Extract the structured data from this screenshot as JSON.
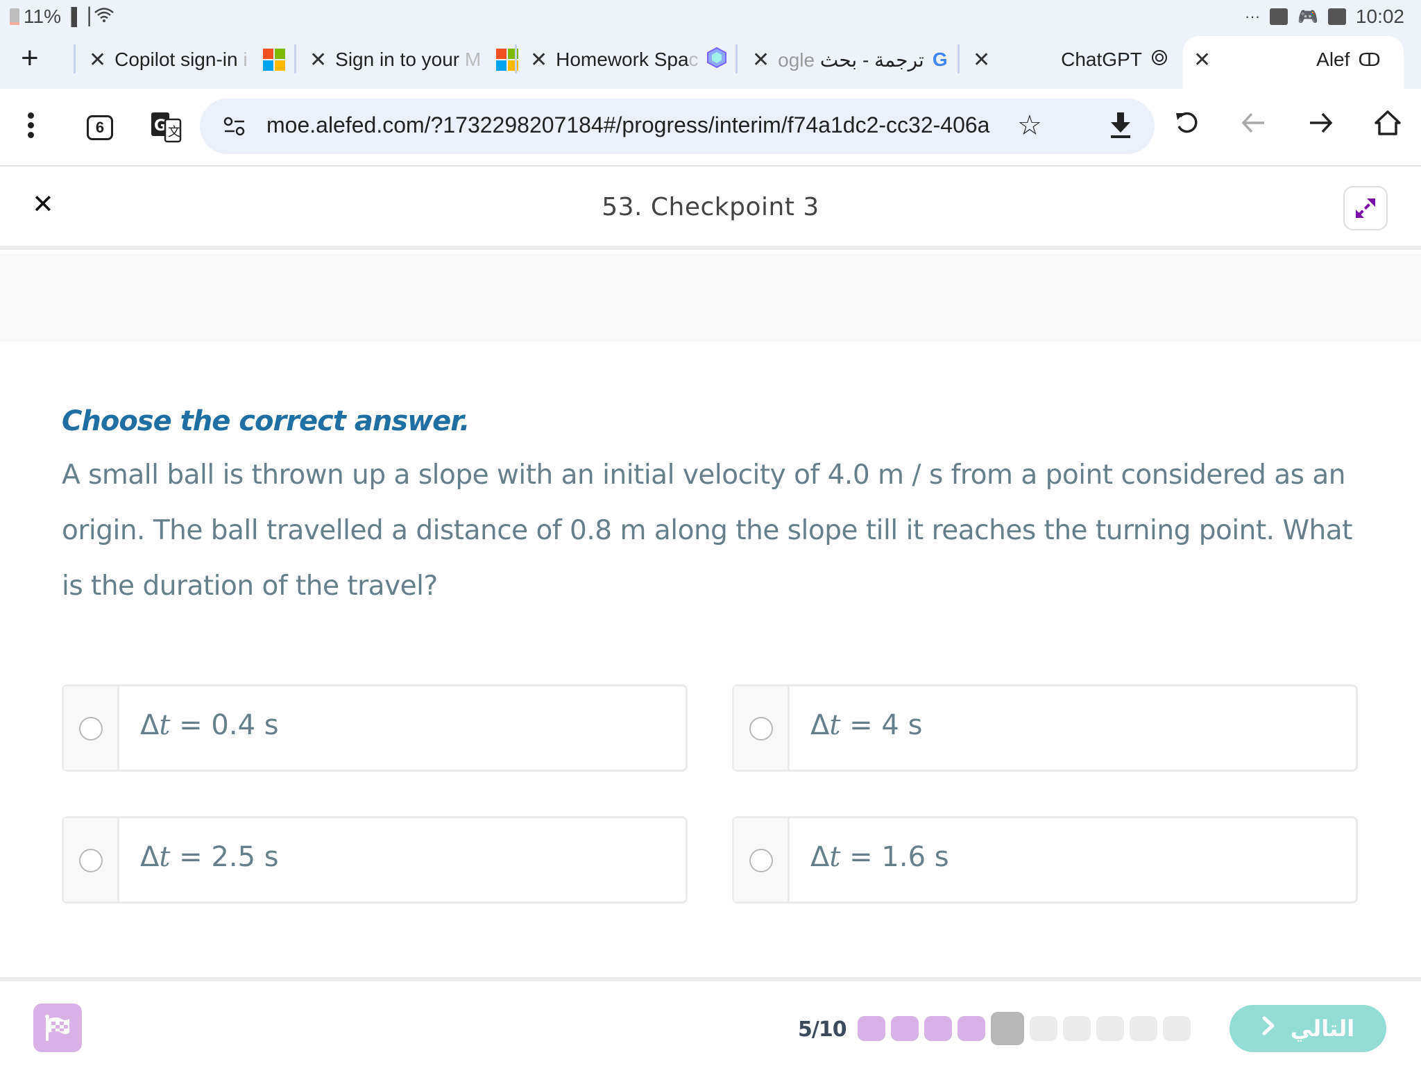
{
  "status_bar": {
    "battery": "11%",
    "time": "10:02",
    "more": "···"
  },
  "tabs": [
    {
      "label": "Copilot sign-in",
      "fade": "i",
      "icon": "microsoft-logo"
    },
    {
      "label": "Sign in to your",
      "fade": "M",
      "icon": "microsoft-logo"
    },
    {
      "label": "Homework Spa",
      "fade": "c",
      "icon": "homework-hex-icon"
    },
    {
      "label": "ترجمة - بحث",
      "fade": "ogle",
      "icon": "google-g-icon"
    },
    {
      "label": "ChatGPT",
      "icon": "openai-icon"
    },
    {
      "label": "Alef",
      "icon": "alef-icon",
      "active": true
    }
  ],
  "toolbar": {
    "tab_count": "6",
    "url": "moe.alefed.com/?1732298207184#/progress/interim/f74a1dc2-cc32-406a"
  },
  "lesson": {
    "title": "53. Checkpoint 3"
  },
  "question": {
    "instruction": "Choose the correct answer.",
    "text": "A small ball is thrown up a slope with an initial velocity of 4.0  m / s from a point considered as an origin. The ball travelled a distance of 0.8  m  along the slope till it reaches the turning point. What is the duration of the travel?",
    "options": [
      {
        "delta": "Δ",
        "var": "t",
        "eq": " = ",
        "value": "0.4 s"
      },
      {
        "delta": "Δ",
        "var": "t",
        "eq": " = ",
        "value": "4 s"
      },
      {
        "delta": "Δ",
        "var": "t",
        "eq": " = ",
        "value": "2.5 s"
      },
      {
        "delta": "Δ",
        "var": "t",
        "eq": " = ",
        "value": "1.6 s"
      }
    ]
  },
  "footer": {
    "progress_label": "5/10",
    "current": 5,
    "total": 10,
    "next_label": "التالي",
    "colors": {
      "done": "#d9b2e5",
      "current": "#b8b8b8",
      "pending": "#ebebeb",
      "next": "#93ddd5"
    }
  }
}
